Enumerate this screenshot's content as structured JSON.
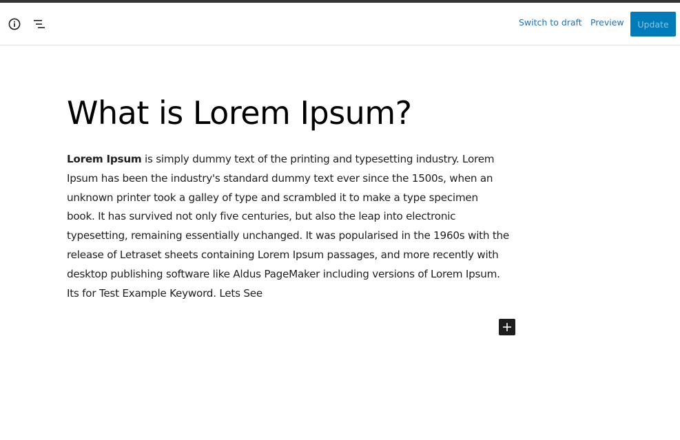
{
  "toolbar": {
    "icons": {
      "info": "info-circle-icon",
      "outline": "list-view-icon",
      "inserter": "plus-icon"
    },
    "switch_to_draft_label": "Switch to draft",
    "preview_label": "Preview",
    "update_label": "Update"
  },
  "post": {
    "title": "What is Lorem Ipsum?",
    "body_bold": "Lorem Ipsum",
    "body_rest": " is simply dummy text of the printing and typesetting industry. Lorem Ipsum has been the industry's standard dummy text ever since the 1500s, when an unknown printer took a galley of type and scrambled it to make a type specimen book. It has survived not only five centuries, but also the leap into electronic typesetting, remaining essentially unchanged. It was popularised in the 1960s with the release of Letraset sheets containing Lorem Ipsum passages, and more recently with desktop publishing software like Aldus PageMaker including versions of Lorem Ipsum. Its for Test Example Keyword. Lets See"
  },
  "colors": {
    "accent": "#007cba",
    "link": "#2271b1",
    "top_strip": "#333537",
    "text": "#1e1e1e"
  }
}
